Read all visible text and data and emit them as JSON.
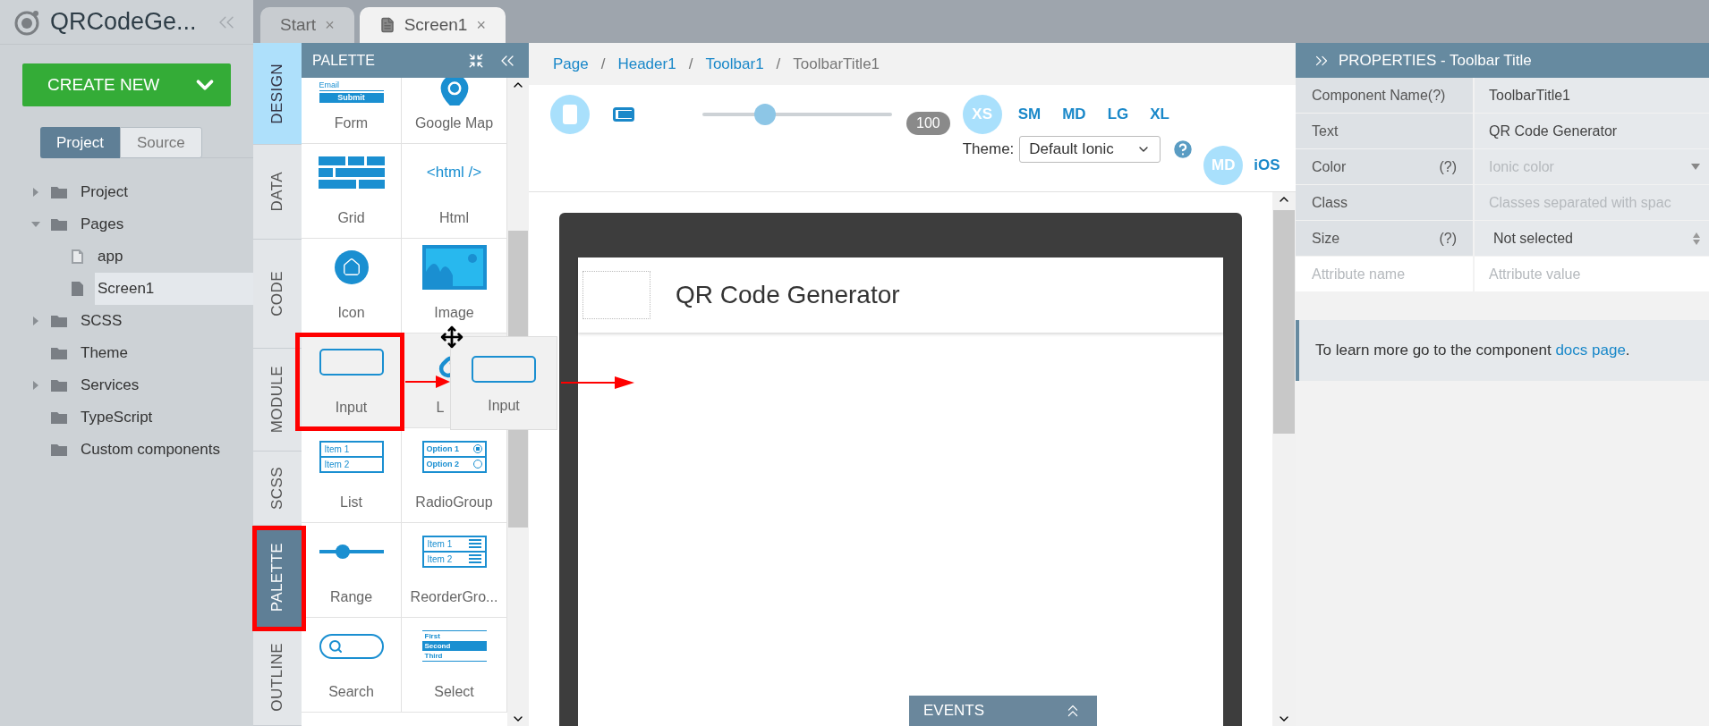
{
  "project": {
    "title": "QRCodeGe...",
    "create_button": "CREATE NEW",
    "view_toggle": [
      {
        "label": "Project",
        "selected": true
      },
      {
        "label": "Source",
        "selected": false
      }
    ],
    "tree": [
      {
        "label": "Project",
        "kind": "folder",
        "expandable": true,
        "expanded": false
      },
      {
        "label": "Pages",
        "kind": "folder",
        "expandable": true,
        "expanded": true,
        "children": [
          {
            "label": "app",
            "kind": "page",
            "selected": false
          },
          {
            "label": "Screen1",
            "kind": "page",
            "selected": true
          }
        ]
      },
      {
        "label": "SCSS",
        "kind": "folder",
        "expandable": true,
        "expanded": false
      },
      {
        "label": "Theme",
        "kind": "folder",
        "expandable": false,
        "expanded": false
      },
      {
        "label": "Services",
        "kind": "folder",
        "expandable": true,
        "expanded": false
      },
      {
        "label": "TypeScript",
        "kind": "folder",
        "expandable": false,
        "expanded": false
      },
      {
        "label": "Custom components",
        "kind": "folder",
        "expandable": false,
        "expanded": false
      }
    ]
  },
  "tabs": [
    {
      "label": "Start",
      "selected": false,
      "close": "×"
    },
    {
      "label": "Screen1",
      "selected": true,
      "close": "×"
    }
  ],
  "side_tabs": [
    {
      "label": "DESIGN",
      "selected": true,
      "open": false,
      "annotated": false
    },
    {
      "label": "DATA",
      "selected": false,
      "open": false,
      "annotated": false
    },
    {
      "label": "CODE",
      "selected": false,
      "open": false,
      "annotated": false
    },
    {
      "label": "MODULE",
      "selected": false,
      "open": false,
      "annotated": false
    },
    {
      "label": "SCSS",
      "selected": false,
      "open": false,
      "annotated": false
    },
    {
      "label": "PALETTE",
      "selected": false,
      "open": true,
      "annotated": true
    },
    {
      "label": "OUTLINE",
      "selected": false,
      "open": false,
      "annotated": false
    }
  ],
  "palette": {
    "title": "PALETTE",
    "items": [
      {
        "label": "Form",
        "kind": "form",
        "annotated": false,
        "icon_texts": [
          "Email",
          "Submit"
        ]
      },
      {
        "label": "Google Map",
        "kind": "map",
        "annotated": false
      },
      {
        "label": "Grid",
        "kind": "grid",
        "annotated": false
      },
      {
        "label": "Html",
        "kind": "html",
        "annotated": false,
        "icon_texts": [
          "<html />"
        ]
      },
      {
        "label": "Icon",
        "kind": "icon",
        "annotated": false
      },
      {
        "label": "Image",
        "kind": "image",
        "annotated": false
      },
      {
        "label": "Input",
        "kind": "input",
        "annotated": true
      },
      {
        "label": "L",
        "kind": "link",
        "annotated": false
      },
      {
        "label": "List",
        "kind": "list",
        "annotated": false,
        "icon_texts": [
          "Item 1",
          "Item 2"
        ]
      },
      {
        "label": "RadioGroup",
        "kind": "radio",
        "annotated": false,
        "icon_texts": [
          "Option 1",
          "Option 2"
        ]
      },
      {
        "label": "Range",
        "kind": "range",
        "annotated": false
      },
      {
        "label": "ReorderGro...",
        "kind": "reorder",
        "annotated": false,
        "icon_texts": [
          "Item 1",
          "Item 2"
        ]
      },
      {
        "label": "Search",
        "kind": "search",
        "annotated": false
      },
      {
        "label": "Select",
        "kind": "select",
        "annotated": false,
        "icon_texts": [
          "First",
          "Second",
          "Third"
        ]
      }
    ]
  },
  "drag_ghost": {
    "label": "Input"
  },
  "breadcrumb": [
    {
      "label": "Page",
      "link": true
    },
    {
      "label": "Header1",
      "link": true,
      "sep": "/"
    },
    {
      "label": "Toolbar1",
      "link": true,
      "sep": "/"
    },
    {
      "label": "ToolbarTitle1",
      "link": false,
      "sep": "/"
    }
  ],
  "toolbar": {
    "devices": [
      {
        "kind": "phone",
        "selected": true
      },
      {
        "kind": "tablet",
        "selected": false
      }
    ],
    "zoom": {
      "level": 0.33,
      "reading": "100"
    },
    "breakpoints": [
      {
        "label": "XS",
        "selected": true
      },
      {
        "label": "SM",
        "selected": false
      },
      {
        "label": "MD",
        "selected": false
      },
      {
        "label": "LG",
        "selected": false
      },
      {
        "label": "XL",
        "selected": false
      }
    ],
    "theme": {
      "label": "Theme:",
      "value": "Default Ionic"
    },
    "platforms": [
      {
        "label": "MD",
        "selected": true
      },
      {
        "label": "iOS",
        "selected": false
      }
    ]
  },
  "canvas": {
    "toolbar_title": "QR Code Generator",
    "events": "EVENTS"
  },
  "properties": {
    "title": "PROPERTIES - Toolbar Title",
    "rows": [
      {
        "label": "Component Name",
        "help": "(?)",
        "help_inline": true,
        "value": "ToolbarTitle1",
        "kind": "text"
      },
      {
        "label": "Text",
        "value": "QR Code Generator",
        "kind": "text"
      },
      {
        "label": "Color",
        "help": "(?)",
        "help_inline": false,
        "placeholder": "Ionic color",
        "kind": "dropdown"
      },
      {
        "label": "Class",
        "placeholder": "Classes separated with spac",
        "kind": "text"
      },
      {
        "label": "Size",
        "help": "(?)",
        "help_inline": false,
        "value": "Not selected",
        "kind": "select"
      },
      {
        "label_placeholder": "Attribute name",
        "placeholder": "Attribute value",
        "kind": "attribute"
      }
    ],
    "info": {
      "text": "To learn more go to the component ",
      "link": "docs page",
      "end": "."
    }
  }
}
